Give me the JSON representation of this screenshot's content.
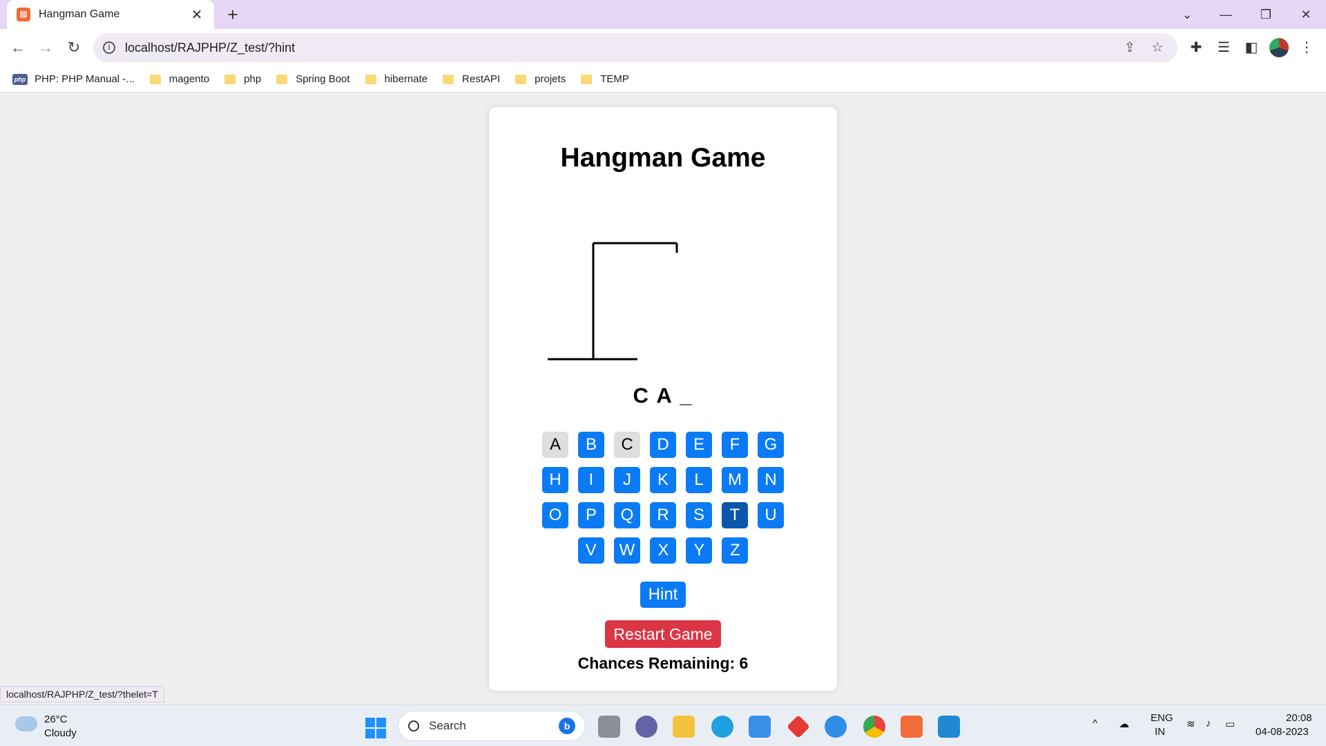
{
  "browser": {
    "tab_title": "Hangman Game",
    "tab_favicon": "xampp-icon",
    "url": "localhost/RAJPHP/Z_test/?hint",
    "status_url": "localhost/RAJPHP/Z_test/?thelet=T",
    "bookmarks": [
      {
        "label": "PHP: PHP Manual -...",
        "icon": "php-icon"
      },
      {
        "label": "magento",
        "icon": "folder-icon"
      },
      {
        "label": "php",
        "icon": "folder-icon"
      },
      {
        "label": "Spring Boot",
        "icon": "folder-icon"
      },
      {
        "label": "hibernate",
        "icon": "folder-icon"
      },
      {
        "label": "RestAPI",
        "icon": "folder-icon"
      },
      {
        "label": "projets",
        "icon": "folder-icon"
      },
      {
        "label": "TEMP",
        "icon": "folder-icon"
      }
    ]
  },
  "game": {
    "title": "Hangman Game",
    "word_display": "C A _",
    "keyboard_rows": [
      [
        {
          "letter": "A",
          "state": "used"
        },
        {
          "letter": "B",
          "state": "available"
        },
        {
          "letter": "C",
          "state": "used"
        },
        {
          "letter": "D",
          "state": "available"
        },
        {
          "letter": "E",
          "state": "available"
        },
        {
          "letter": "F",
          "state": "available"
        },
        {
          "letter": "G",
          "state": "available"
        }
      ],
      [
        {
          "letter": "H",
          "state": "available"
        },
        {
          "letter": "I",
          "state": "available"
        },
        {
          "letter": "J",
          "state": "available"
        },
        {
          "letter": "K",
          "state": "available"
        },
        {
          "letter": "L",
          "state": "available"
        },
        {
          "letter": "M",
          "state": "available"
        },
        {
          "letter": "N",
          "state": "available"
        }
      ],
      [
        {
          "letter": "O",
          "state": "available"
        },
        {
          "letter": "P",
          "state": "available"
        },
        {
          "letter": "Q",
          "state": "available"
        },
        {
          "letter": "R",
          "state": "available"
        },
        {
          "letter": "S",
          "state": "available"
        },
        {
          "letter": "T",
          "state": "hover"
        },
        {
          "letter": "U",
          "state": "available"
        }
      ],
      [
        {
          "letter": "V",
          "state": "available"
        },
        {
          "letter": "W",
          "state": "available"
        },
        {
          "letter": "X",
          "state": "available"
        },
        {
          "letter": "Y",
          "state": "available"
        },
        {
          "letter": "Z",
          "state": "available"
        }
      ]
    ],
    "hint_label": "Hint",
    "restart_label": "Restart Game",
    "chances_label": "Chances Remaining: 6",
    "colors": {
      "primary": "#0b7bf5",
      "danger": "#dc3545",
      "used": "#dedede",
      "hover": "#0a56ad"
    }
  },
  "taskbar": {
    "weather_temp": "26°C",
    "weather_condition": "Cloudy",
    "search_label": "Search",
    "language": "ENG",
    "region": "IN",
    "time": "20:08",
    "date": "04-08-2023",
    "apps": [
      "file-explorer-icon",
      "teams-icon",
      "folder-icon",
      "edge-icon",
      "store-icon",
      "anydesk-icon",
      "help-icon",
      "chrome-icon",
      "xampp-icon",
      "vscode-icon"
    ]
  }
}
